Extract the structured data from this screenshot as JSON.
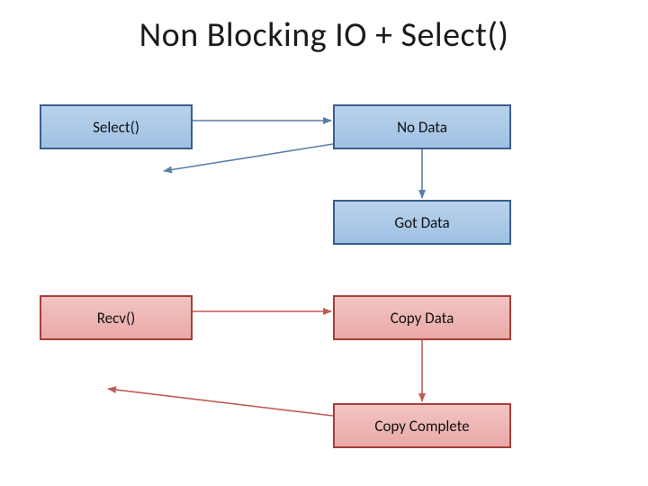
{
  "title": "Non Blocking IO + Select()",
  "nodes": {
    "select": {
      "label": "Select()"
    },
    "no_data": {
      "label": "No Data"
    },
    "got_data": {
      "label": "Got Data"
    },
    "recv": {
      "label": "Recv()"
    },
    "copy_data": {
      "label": "Copy Data"
    },
    "copy_complete": {
      "label": "Copy Complete"
    }
  },
  "colors": {
    "blue_arrow": "#5b7fa8",
    "red_arrow": "#c45a57"
  }
}
